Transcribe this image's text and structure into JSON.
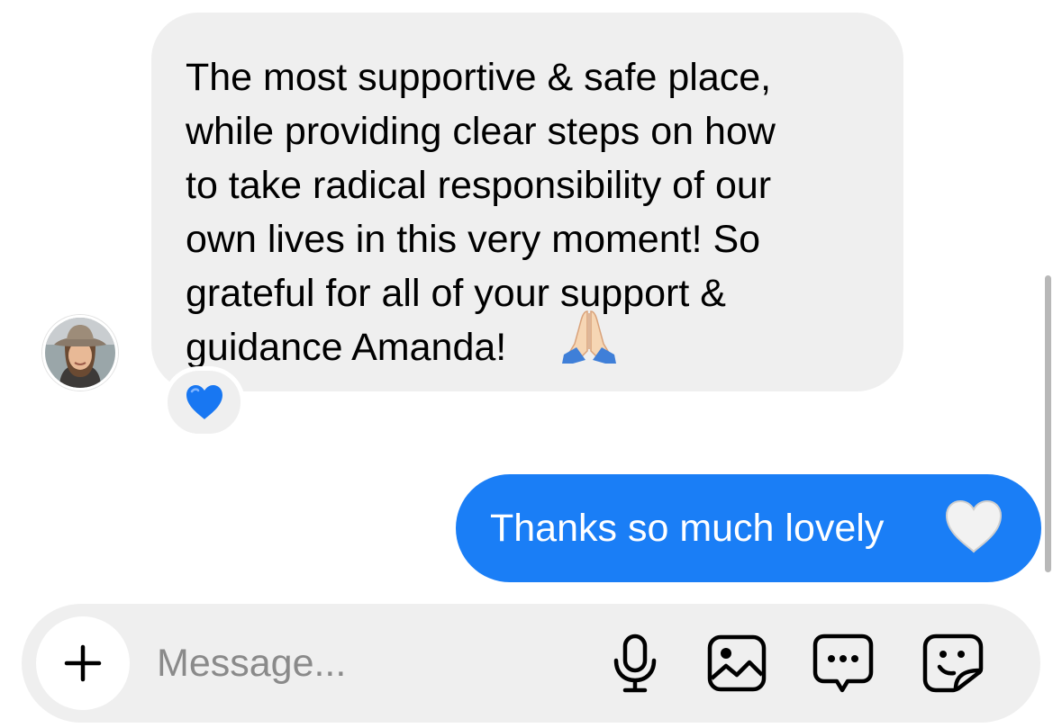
{
  "conversation": {
    "incoming": {
      "text": "The most supportive & safe place,\nwhile providing clear steps on how\nto take radical responsibility of our\nown lives in this very moment! So\ngrateful for all of your support &\nguidance Amanda!",
      "emoji": "folded-hands-icon",
      "reaction": "blue-heart-icon",
      "avatar": "user-avatar"
    },
    "outgoing": {
      "text": "Thanks so much lovely",
      "emoji": "white-heart-icon"
    }
  },
  "composer": {
    "placeholder": "Message...",
    "icons": [
      "plus-icon",
      "microphone-icon",
      "gallery-icon",
      "chat-bubble-icon",
      "sticker-icon"
    ]
  },
  "colors": {
    "incoming_bubble": "#efefef",
    "outgoing_bubble": "#1a7ef6",
    "blue_heart": "#1877f2",
    "composer_bg": "#efefef"
  }
}
